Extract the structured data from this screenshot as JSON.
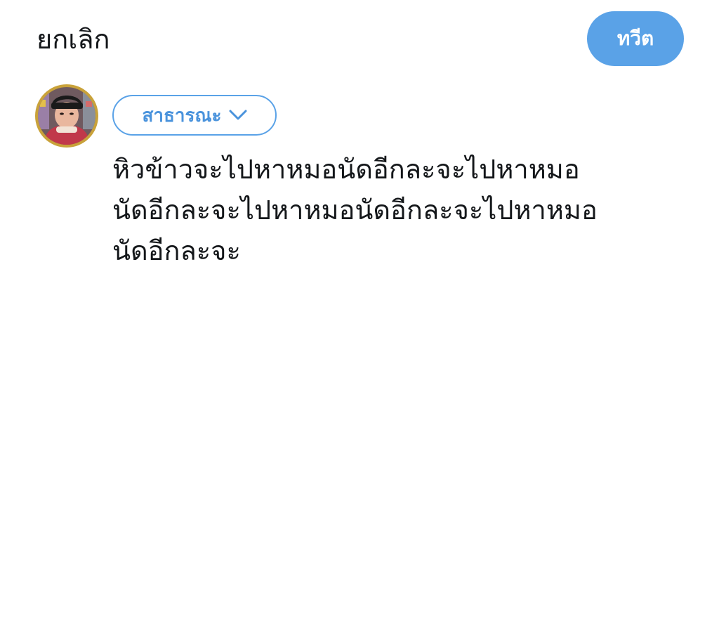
{
  "header": {
    "cancel_label": "ยกเลิก",
    "tweet_label": "ทวีต"
  },
  "composer": {
    "audience_label": "สาธารณะ",
    "text_lines": [
      "หิวข้าวจะไปหาหมอนัดอีกละจะไปหาหมอ",
      "นัดอีกละจะไปหาหมอนัดอีกละจะไปหาหมอ",
      "นัดอีกละจะ"
    ]
  },
  "colors": {
    "accent": "#5aa2e7",
    "text": "#14171a",
    "background": "#ffffff"
  },
  "icons": {
    "audience_chevron": "chevron-down-icon",
    "avatar": "user-avatar"
  }
}
